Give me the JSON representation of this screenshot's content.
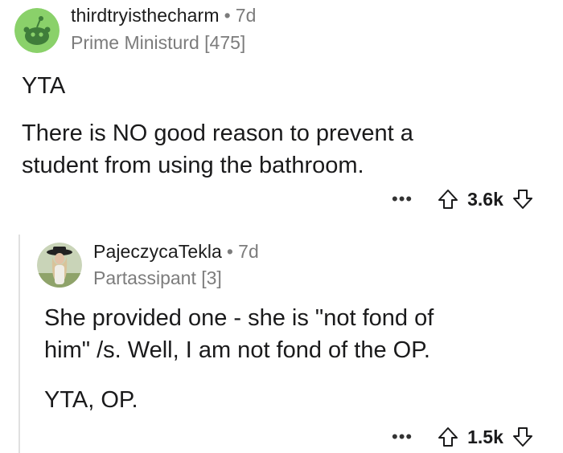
{
  "comments": [
    {
      "username": "thirdtryisthecharm",
      "age": "7d",
      "flair": "Prime Ministurd [475]",
      "body": [
        "YTA",
        "There is NO good reason to prevent a",
        "student from using the bathroom."
      ],
      "votes": "3.6k",
      "more_label": "•••"
    },
    {
      "username": "PajeczycaTekla",
      "age": "7d",
      "flair": "Partassipant [3]",
      "body": [
        "She provided one - she is \"not fond of",
        "him\" /s. Well, I am not fond of the OP.",
        "YTA, OP."
      ],
      "votes": "1.5k",
      "more_label": "•••"
    }
  ],
  "separator": "•",
  "colors": {
    "avatar_bg": "#8ad16a",
    "meta_gray": "#7c7c7c",
    "thread_line": "#e0e0e0"
  },
  "icons": [
    "reddit-snoo-avatar",
    "upvote-arrow-icon",
    "downvote-arrow-icon",
    "more-options-icon"
  ]
}
